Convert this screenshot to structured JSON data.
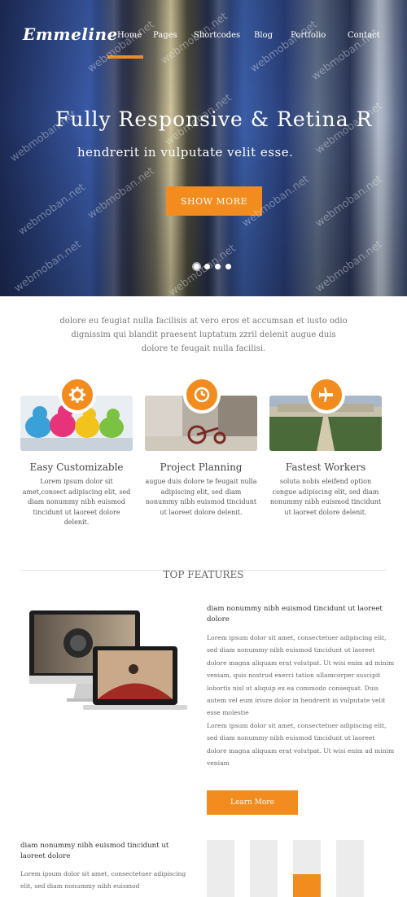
{
  "brand": {
    "logo": "Emmeline",
    "accent": "#f28c1e"
  },
  "nav": {
    "items": [
      {
        "label": "Home",
        "active": true
      },
      {
        "label": "Pages"
      },
      {
        "label": "Shortcodes"
      },
      {
        "label": "Blog"
      },
      {
        "label": "Portfolio"
      },
      {
        "label": "Contact"
      }
    ]
  },
  "hero": {
    "title": "Fully Responsive & Retina R",
    "subtitle": "hendrerit in vulputate velit esse.",
    "button": "SHOW MORE",
    "slides": 4,
    "active_slide": 1
  },
  "watermark": "webmoban.net",
  "intro": "dolore eu feugiat nulla facilisis at vero eros et accumsan et iusto odio dignissim qui blandit praesent luptatum zzril delenit augue duis dolore te feugait nulla facilisi.",
  "services": [
    {
      "icon": "gear-icon",
      "title": "Easy Customizable",
      "text": "Lorem ipsum dolor sit amet,consect adipiscing elit, sed diam nonummy nibh euismod tincidunt ut laoreet dolore delenit."
    },
    {
      "icon": "clock-icon",
      "title": "Project Planning",
      "text": "augue duis dolore te feugait nulla adipiscing elit, sed diam nonummy nibh euismod tincidunt ut laoreet dolore delenit."
    },
    {
      "icon": "airplane-icon",
      "title": "Fastest Workers",
      "text": "soluta nobis eleifend option congue adipiscing elit, sed diam nonummy nibh euismod tincidunt ut laoreet dolore delenit."
    }
  ],
  "features": {
    "title": "TOP FEATURES",
    "heading": "diam nonummy nibh euismod tincidunt ut laoreet dolore",
    "paragraph1": "Lorem ipsum dolor sit amet, consectetuer adipiscing elit, sed diam nonummy nibh euismod tincidunt ut laoreet dolore magna aliquam erat volutpat. Ut wisi enim ad minim veniam, quis nostrud exerci tation ullamcorper suscipit lobortis nisl ut aliquip ex ea commodo consequat. Duis autem vel eum iriure dolor in hendrerit in vulputate velit esse molestie",
    "paragraph2": "Lorem ipsum dolor sit amet, consectetuer adipiscing elit, sed diam nonummy nibh euismod tincidunt ut laoreet dolore magna aliquam erat volutpat. Ut wisi enim ad minim veniam",
    "button": "Learn More"
  },
  "bottom": {
    "heading": "diam nonummy nibh euismod tincidunt ut laoreet dolore",
    "text": "Lorem ipsum dolor sit amet, consectetuer adipiscing elit, sed diam nonummy nibh euismod",
    "bars": [
      0,
      0,
      0.4,
      0
    ]
  }
}
